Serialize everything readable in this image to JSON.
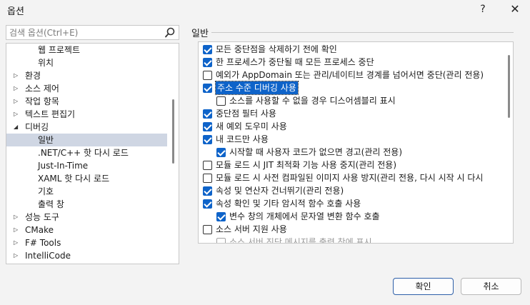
{
  "window": {
    "title": "옵션",
    "help_label": "?",
    "close_label": "✕"
  },
  "search": {
    "placeholder": "검색 옵션(Ctrl+E)"
  },
  "tree": {
    "items": [
      {
        "label": "웹 프로젝트",
        "level": 2,
        "expander": "",
        "selected": false
      },
      {
        "label": "위치",
        "level": 2,
        "expander": "",
        "selected": false
      },
      {
        "label": "환경",
        "level": 1,
        "expander": "▷",
        "selected": false
      },
      {
        "label": "소스 제어",
        "level": 1,
        "expander": "▷",
        "selected": false
      },
      {
        "label": "작업 항목",
        "level": 1,
        "expander": "▷",
        "selected": false
      },
      {
        "label": "텍스트 편집기",
        "level": 1,
        "expander": "▷",
        "selected": false
      },
      {
        "label": "디버깅",
        "level": 1,
        "expander": "◢",
        "selected": false
      },
      {
        "label": "일반",
        "level": 2,
        "expander": "",
        "selected": true
      },
      {
        "label": ".NET/C++ 핫 다시 로드",
        "level": 2,
        "expander": "",
        "selected": false
      },
      {
        "label": "Just-In-Time",
        "level": 2,
        "expander": "",
        "selected": false
      },
      {
        "label": "XAML 핫 다시 로드",
        "level": 2,
        "expander": "",
        "selected": false
      },
      {
        "label": "기호",
        "level": 2,
        "expander": "",
        "selected": false
      },
      {
        "label": "출력 창",
        "level": 2,
        "expander": "",
        "selected": false
      },
      {
        "label": "성능 도구",
        "level": 1,
        "expander": "▷",
        "selected": false
      },
      {
        "label": "CMake",
        "level": 1,
        "expander": "▷",
        "selected": false
      },
      {
        "label": "F# Tools",
        "level": 1,
        "expander": "▷",
        "selected": false
      },
      {
        "label": "IntelliCode",
        "level": 1,
        "expander": "▷",
        "selected": false
      }
    ]
  },
  "section": {
    "title": "일반"
  },
  "options": [
    {
      "label": "모든 중단점을 삭제하기 전에 확인",
      "checked": true,
      "indent": 0
    },
    {
      "label": "한 프로세스가 중단될 때 모든 프로세스 중단",
      "checked": true,
      "indent": 0
    },
    {
      "label": "예외가 AppDomain 또는 관리/네이티브 경계를 넘어서면 중단(관리 전용)",
      "checked": false,
      "indent": 0
    },
    {
      "label": "주소 수준 디버깅 사용",
      "checked": true,
      "indent": 0,
      "selected": true
    },
    {
      "label": "소스를 사용할 수 없을 경우 디스어셈블리 표시",
      "checked": false,
      "indent": 1
    },
    {
      "label": "중단점 필터 사용",
      "checked": true,
      "indent": 0
    },
    {
      "label": "새 예외 도우미 사용",
      "checked": true,
      "indent": 0
    },
    {
      "label": "내 코드만 사용",
      "checked": true,
      "indent": 0
    },
    {
      "label": "시작할 때 사용자 코드가 없으면 경고(관리 전용)",
      "checked": true,
      "indent": 1
    },
    {
      "label": "모듈 로드 시 JIT 최적화 기능 사용 중지(관리 전용)",
      "checked": false,
      "indent": 0
    },
    {
      "label": "모듈 로드 시 사전 컴파일된 이미지 사용 방지(관리 전용, 다시 시작 시 다시",
      "checked": false,
      "indent": 0
    },
    {
      "label": "속성 및 연산자 건너뛰기(관리 전용)",
      "checked": true,
      "indent": 0
    },
    {
      "label": "속성 확인 및 기타 암시적 함수 호출 사용",
      "checked": true,
      "indent": 0
    },
    {
      "label": "변수 창의 개체에서 문자열 변환 함수 호출",
      "checked": true,
      "indent": 1
    },
    {
      "label": "소스 서버 지원 사용",
      "checked": false,
      "indent": 0
    },
    {
      "label": "소스 서버 진단 메시지를 출력 창에 표시",
      "checked": false,
      "indent": 1,
      "faded": true
    }
  ],
  "buttons": {
    "ok_label": "확인",
    "cancel_label": "취소"
  }
}
